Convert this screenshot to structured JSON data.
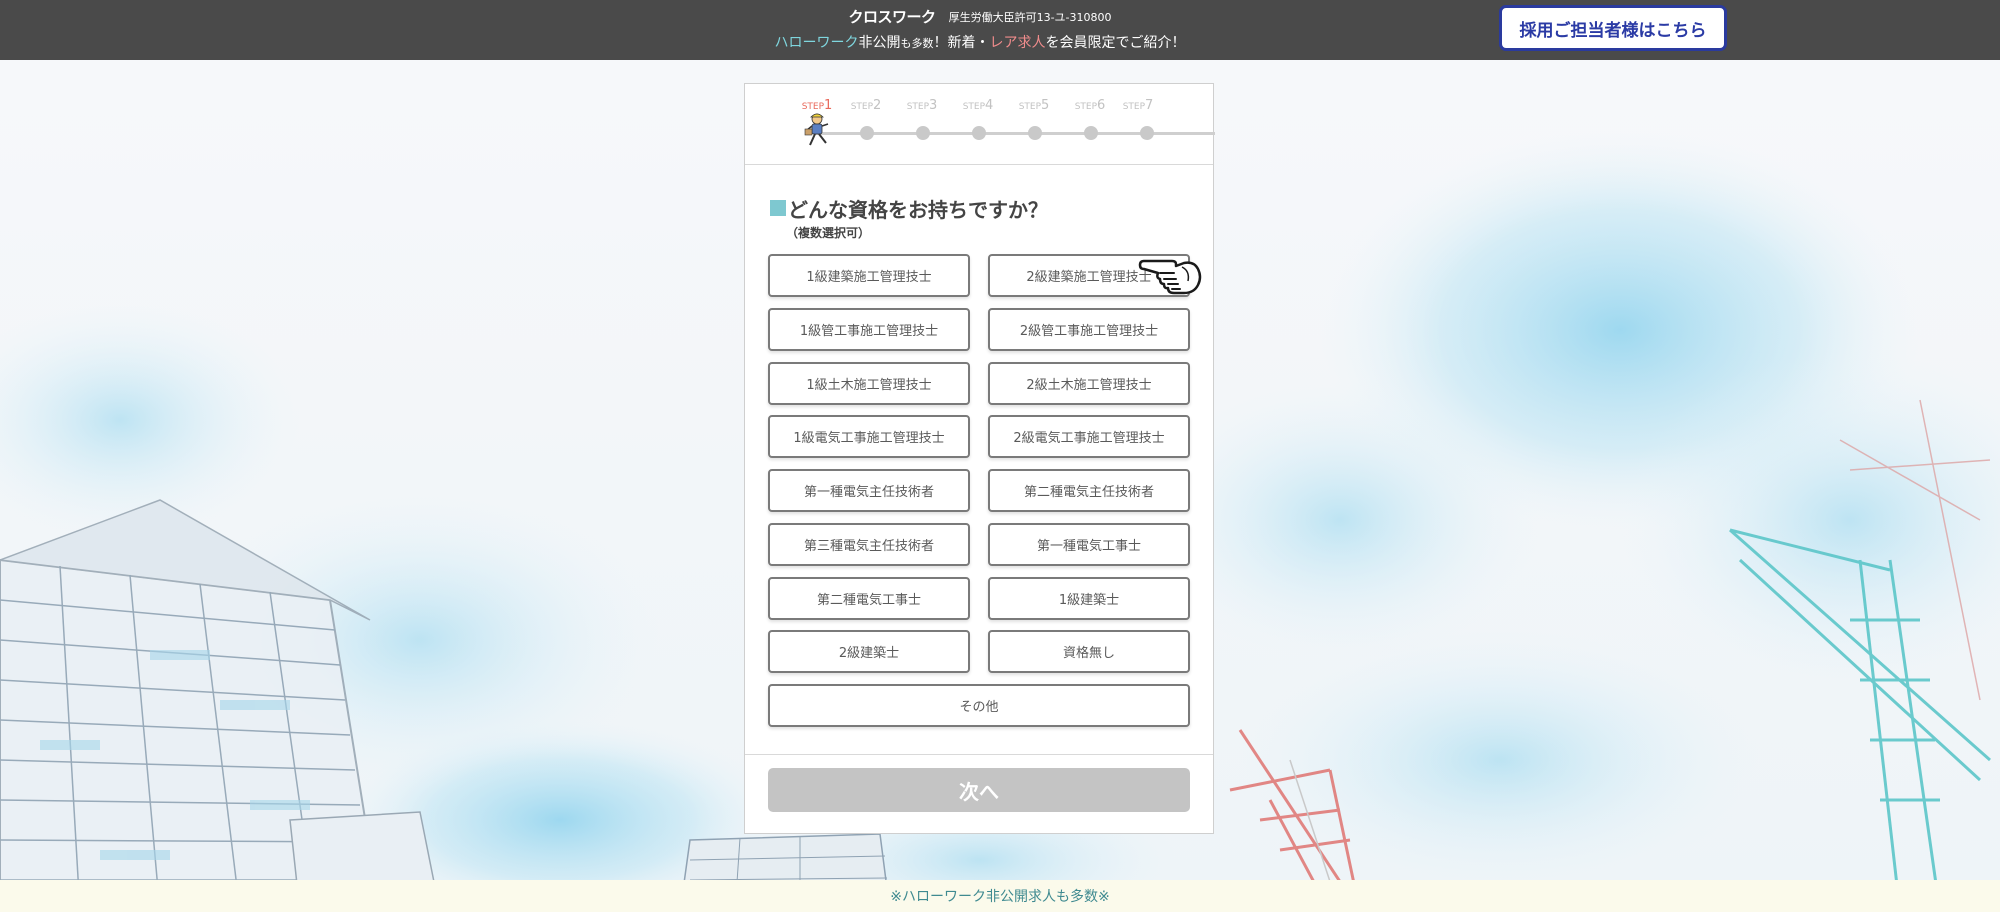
{
  "header": {
    "logo": "クロスワーク",
    "license": "厚生労働大臣許可13-ユ-310800",
    "tagline_part1": "ハローワーク",
    "tagline_part2": "非公開",
    "tagline_part3": "も多数",
    "tagline_part4": "！新着・",
    "tagline_part5": "レア求人",
    "tagline_part6": "を会員限定でご紹介！",
    "recruiter_button": "採用ご担当者様はこちら"
  },
  "stepper": {
    "steps": [
      {
        "word": "STEP",
        "num": "1"
      },
      {
        "word": "STEP",
        "num": "2"
      },
      {
        "word": "STEP",
        "num": "3"
      },
      {
        "word": "STEP",
        "num": "4"
      },
      {
        "word": "STEP",
        "num": "5"
      },
      {
        "word": "STEP",
        "num": "6"
      },
      {
        "word": "STEP",
        "num": "7"
      }
    ],
    "current": 1
  },
  "question": {
    "title": "どんな資格をお持ちですか？",
    "subtitle": "（複数選択可）"
  },
  "options": [
    "1級建築施工管理技士",
    "2級建築施工管理技士",
    "1級管工事施工管理技士",
    "2級管工事施工管理技士",
    "1級土木施工管理技士",
    "2級土木施工管理技士",
    "1級電気工事施工管理技士",
    "2級電気工事施工管理技士",
    "第一種電気主任技術者",
    "第二種電気主任技術者",
    "第三種電気主任技術者",
    "第一種電気工事士",
    "第二種電気工事士",
    "1級建築士",
    "2級建築士",
    "資格無し",
    "その他"
  ],
  "next_button": "次へ",
  "footer": {
    "text": "※ハローワーク非公開求人も多数※"
  },
  "colors": {
    "header_bg": "#4a4a4a",
    "accent_teal": "#7ec8d0",
    "active_step": "#e96a5c",
    "recruiter_border": "#2a3a9e",
    "next_disabled": "#c4c4c4",
    "footer_bg": "#fbfaeb",
    "footer_text": "#3f8a90"
  },
  "icons": {
    "worker": "running-worker-icon",
    "hand": "pointing-hand-icon"
  }
}
